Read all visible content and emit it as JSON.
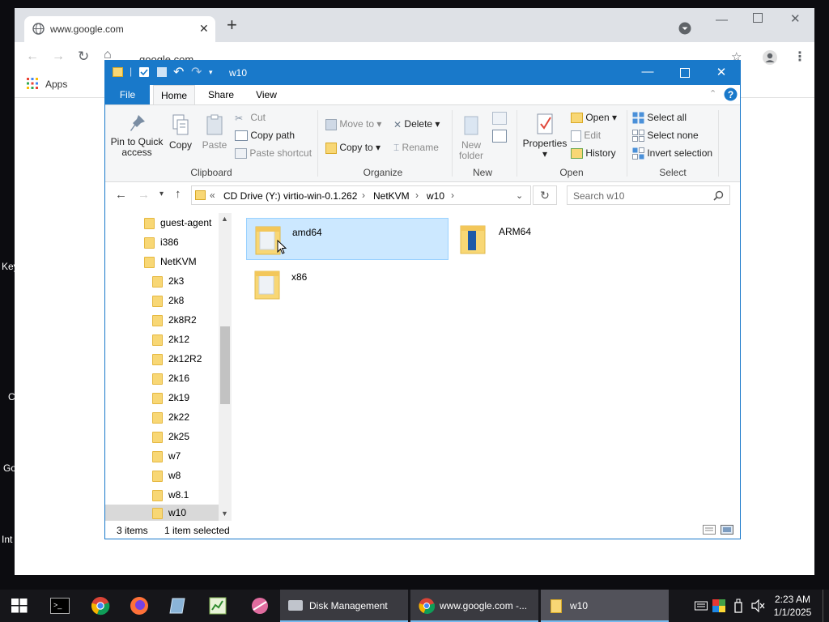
{
  "desktop": {
    "fragments": [
      "Key",
      "C",
      "Go",
      "Int"
    ]
  },
  "chrome": {
    "tab_title": "www.google.com",
    "address": "google.com",
    "bookmark_apps": "Apps"
  },
  "explorer": {
    "title": "w10",
    "ribbon_tabs": [
      "File",
      "Home",
      "Share",
      "View"
    ],
    "clipboard": {
      "pin_label": "Pin to Quick access",
      "copy_label": "Copy",
      "paste_label": "Paste",
      "cut_label": "Cut",
      "copy_path_label": "Copy path",
      "paste_shortcut_label": "Paste shortcut",
      "group_label": "Clipboard"
    },
    "organize": {
      "move_to_label": "Move to",
      "delete_label": "Delete",
      "copy_to_label": "Copy to",
      "rename_label": "Rename",
      "group_label": "Organize"
    },
    "new": {
      "new_folder_label": "New folder",
      "group_label": "New"
    },
    "open": {
      "properties_label": "Properties",
      "open_label": "Open",
      "edit_label": "Edit",
      "history_label": "History",
      "group_label": "Open"
    },
    "select": {
      "select_all_label": "Select all",
      "select_none_label": "Select none",
      "invert_label": "Invert selection",
      "group_label": "Select"
    },
    "breadcrumb": {
      "prefix": "«",
      "parts": [
        "CD Drive (Y:) virtio-win-0.1.262",
        "NetKVM",
        "w10"
      ],
      "sep": "›"
    },
    "search_placeholder": "Search w10",
    "nav_tree": [
      "guest-agent",
      "i386",
      "NetKVM",
      "2k3",
      "2k8",
      "2k8R2",
      "2k12",
      "2k12R2",
      "2k16",
      "2k19",
      "2k22",
      "2k25",
      "w7",
      "w8",
      "w8.1",
      "w10"
    ],
    "items": [
      "amd64",
      "ARM64",
      "x86"
    ],
    "status_count": "3 items",
    "status_selected": "1 item selected"
  },
  "taskbar": {
    "apps": [
      "Disk Management",
      "www.google.com -...",
      "w10"
    ],
    "time": "2:23 AM",
    "date": "1/1/2025"
  },
  "colors": {
    "accent": "#1979ca",
    "selection": "#cce8ff",
    "folder": "#f8d775"
  }
}
